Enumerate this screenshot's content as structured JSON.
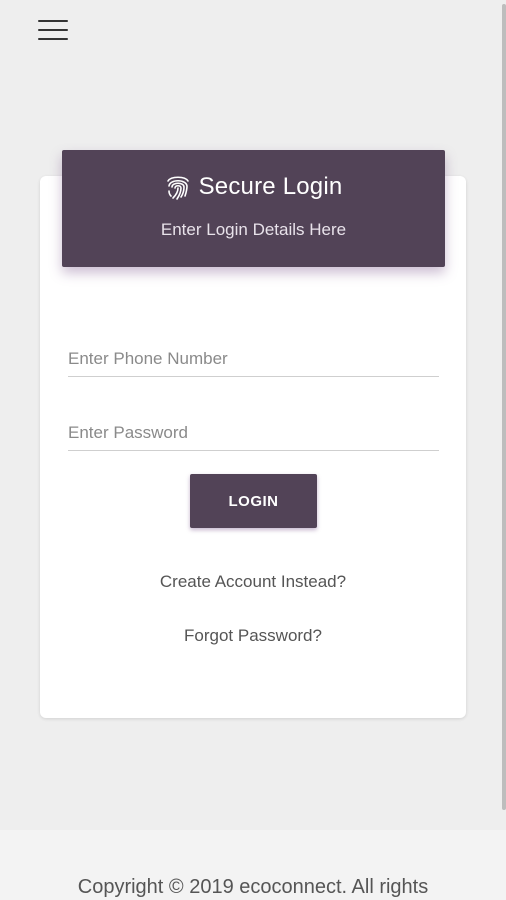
{
  "nav": {
    "menu_icon": "hamburger-menu-icon"
  },
  "login_card": {
    "header": {
      "icon": "fingerprint-icon",
      "title": "Secure Login",
      "subtitle": "Enter Login Details Here"
    },
    "phone_field": {
      "value": "",
      "placeholder": "Enter Phone Number"
    },
    "password_field": {
      "value": "",
      "placeholder": "Enter Password"
    },
    "login_button_label": "LOGIN",
    "create_account_link": "Create Account Instead?",
    "forgot_password_link": "Forgot Password?"
  },
  "footer": {
    "copyright": "Copyright © 2019 ecoconnect. All rights"
  },
  "colors": {
    "brand": "#524357",
    "background": "#eeeeee",
    "card": "#ffffff"
  }
}
